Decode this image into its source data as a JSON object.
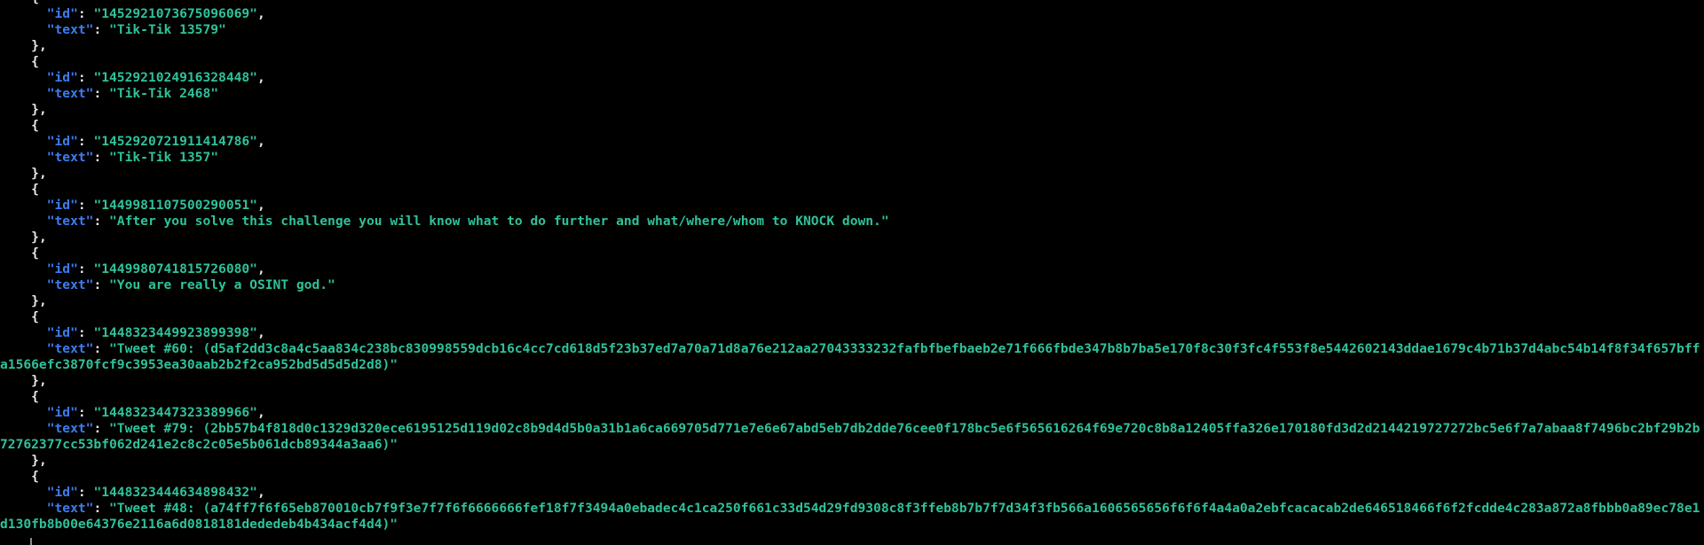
{
  "colors": {
    "background": "#000000",
    "key": "#3d7cf0",
    "string": "#2fc29a",
    "punctuation": "#e8e8e8"
  },
  "json": {
    "id_key": "\"id\"",
    "text_key": "\"text\"",
    "open_brace": "{",
    "close_brace_comma": "},"
  },
  "records": [
    {
      "id": "\"1452921073675096069\"",
      "text": "\"Tik-Tik 13579\""
    },
    {
      "id": "\"1452921024916328448\"",
      "text": "\"Tik-Tik 2468\""
    },
    {
      "id": "\"1452920721911414786\"",
      "text": "\"Tik-Tik 1357\""
    },
    {
      "id": "\"1449981107500290051\"",
      "text": "\"After you solve this challenge you will know what to do further and what/where/whom to KNOCK down.\""
    },
    {
      "id": "\"1449980741815726080\"",
      "text": "\"You are really a OSINT god.\""
    },
    {
      "id": "\"1448323449923899398\"",
      "text": "\"Tweet #60: (d5af2dd3c8a4c5aa834c238bc830998559dcb16c4cc7cd618d5f23b37ed7a70a71d8a76e212aa27043333232fafbfbefbaeb2e71f666fbde347b8b7ba5e170f8c30f3fc4f553f8e5442602143ddae1679c4b71b37d4abc54b14f8f34f657bffa1566efc3870fcf9c3953ea30aab2b2f2ca952bd5d5d5d2d8)\""
    },
    {
      "id": "\"1448323447323389966\"",
      "text": "\"Tweet #79: (2bb57b4f818d0c1329d320ece6195125d119d02c8b9d4d5b0a31b1a6ca669705d771e7e6e67abd5eb7db2dde76cee0f178bc5e6f565616264f69e720c8b8a12405ffa326e170180fd3d2d2144219727272bc5e6f7a7abaa8f7496bc2bf29b2b72762377cc53bf062d241e2c8c2c05e5b061dcb89344a3aa6)\""
    },
    {
      "id": "\"1448323444634898432\"",
      "text": "\"Tweet #48: (a74ff7f6f65eb870010cb7f9f3e7f7f6f6666666fef18f7f3494a0ebadec4c1ca250f661c33d54d29fd9308c8f3ffeb8b7b7f7d34f3fb566a1606565656f6f6f4a4a0a2ebfcacacab2de646518466f6f2fcdde4c283a872a8fbbb0a89ec78e1d130fb8b00e64376e2116a6d0818181dededeb4b434acf4d4)\""
    }
  ]
}
